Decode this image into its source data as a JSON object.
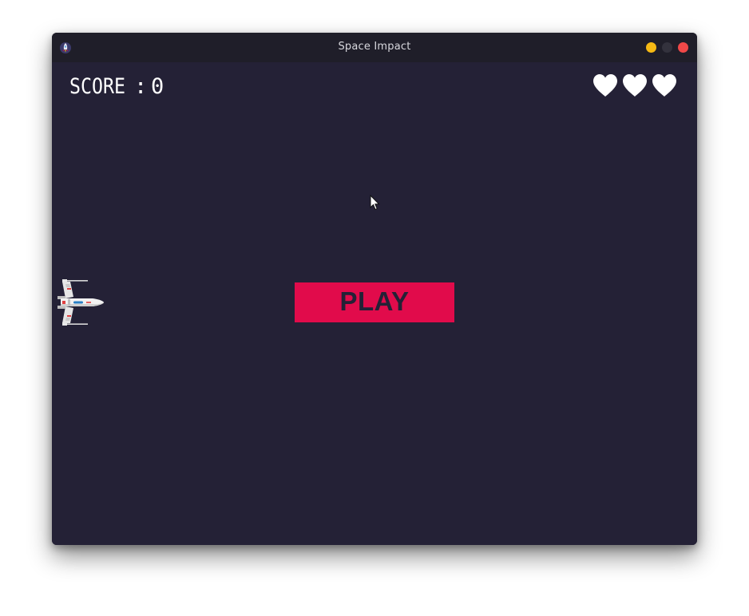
{
  "window": {
    "title": "Space Impact",
    "controls": [
      "minimize",
      "maximize",
      "close"
    ]
  },
  "hud": {
    "score_label": "SCORE",
    "score_separator": ":",
    "score_value": "0",
    "lives": 3,
    "life_icon": "heart-icon"
  },
  "menu": {
    "play_label": "PLAY"
  },
  "player": {
    "sprite": "spaceship-icon"
  },
  "colors": {
    "background": "#242136",
    "titlebar": "#1f1e29",
    "play_button": "#e10b4b",
    "hud_text": "#ffffff",
    "minimize": "#f5b914",
    "maximize": "#33323d",
    "close": "#f04848"
  }
}
